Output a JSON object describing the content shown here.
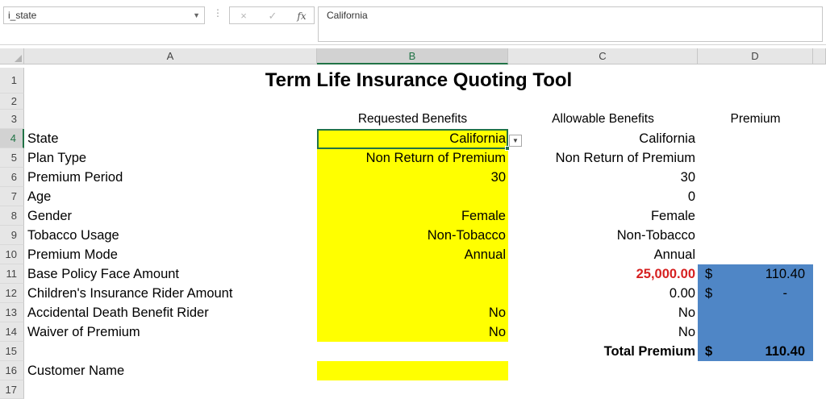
{
  "formula_bar": {
    "name_box": "i_state",
    "cancel_icon": "×",
    "enter_icon": "✓",
    "fx_label": "fx",
    "formula": "California"
  },
  "columns": [
    "A",
    "B",
    "C",
    "D"
  ],
  "rows": [
    "1",
    "2",
    "3",
    "4",
    "5",
    "6",
    "7",
    "8",
    "9",
    "10",
    "11",
    "12",
    "13",
    "14",
    "15",
    "16",
    "17"
  ],
  "title": "Term Life Insurance Quoting Tool",
  "headers": {
    "requested": "Requested Benefits",
    "allowable": "Allowable Benefits",
    "premium": "Premium"
  },
  "labels": {
    "state": "State",
    "plan_type": "Plan Type",
    "premium_period": "Premium Period",
    "age": "Age",
    "gender": "Gender",
    "tobacco": "Tobacco Usage",
    "premium_mode": "Premium Mode",
    "base_face": "Base Policy Face Amount",
    "child_rider": "Children's Insurance Rider Amount",
    "accidental": "Accidental Death Benefit Rider",
    "waiver": "Waiver of Premium",
    "customer": "Customer Name"
  },
  "requested": {
    "state": "California",
    "plan_type": "Non Return of Premium",
    "premium_period": "30",
    "gender": "Female",
    "tobacco": "Non-Tobacco",
    "premium_mode": "Annual",
    "accidental": "No",
    "waiver": "No"
  },
  "allowable": {
    "state": "California",
    "plan_type": "Non Return of Premium",
    "premium_period": "30",
    "age": "0",
    "gender": "Female",
    "tobacco": "Non-Tobacco",
    "premium_mode": "Annual",
    "base_face": "25,000.00",
    "child_rider": "0.00",
    "accidental": "No",
    "waiver": "No"
  },
  "total_label": "Total Premium",
  "premium": {
    "currency": "$",
    "base": "110.40",
    "child": "-",
    "total": "110.40"
  },
  "dropdown_icon": "▼",
  "colors": {
    "input_fill": "#ffff00",
    "premium_fill": "#4f86c6",
    "warning_text": "#d62020",
    "selection": "#217346"
  }
}
